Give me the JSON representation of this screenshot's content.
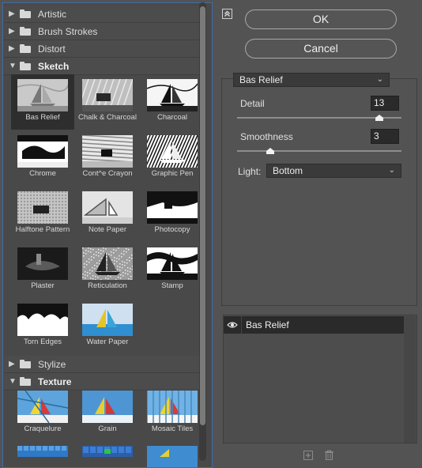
{
  "browser": {
    "categories_top": [
      {
        "id": "artistic",
        "label": "Artistic",
        "open": false
      },
      {
        "id": "brush-strokes",
        "label": "Brush Strokes",
        "open": false
      },
      {
        "id": "distort",
        "label": "Distort",
        "open": false
      },
      {
        "id": "sketch",
        "label": "Sketch",
        "open": true
      }
    ],
    "sketch_filters": [
      "Bas Relief",
      "Chalk & Charcoal",
      "Charcoal",
      "Chrome",
      "Cont^e Crayon",
      "Graphic Pen",
      "Halftone Pattern",
      "Note Paper",
      "Photocopy",
      "Plaster",
      "Reticulation",
      "Stamp",
      "Torn Edges",
      "Water Paper"
    ],
    "selected_filter": "Bas Relief",
    "categories_bottom": [
      {
        "id": "stylize",
        "label": "Stylize",
        "open": false
      },
      {
        "id": "texture",
        "label": "Texture",
        "open": true
      }
    ],
    "texture_filters": [
      "Craquelure",
      "Grain",
      "Mosaic Tiles"
    ]
  },
  "buttons": {
    "ok": "OK",
    "cancel": "Cancel"
  },
  "settings": {
    "filter_select": "Bas Relief",
    "detail_label": "Detail",
    "detail_value": "13",
    "detail_max": 15,
    "smoothness_label": "Smoothness",
    "smoothness_value": "3",
    "smoothness_max": 15,
    "light_label": "Light:",
    "light_value": "Bottom"
  },
  "layers": {
    "items": [
      {
        "name": "Bas Relief",
        "visible": true
      }
    ]
  },
  "icons": {
    "collapse": "collapse-icon",
    "eye": "eye-icon",
    "new_layer": "new-layer-icon",
    "delete": "trash-icon",
    "folder": "folder-icon"
  },
  "colors": {
    "panel": "#535353",
    "focus_border": "#3d6ea8",
    "selected_bg": "#2e2e2e"
  }
}
